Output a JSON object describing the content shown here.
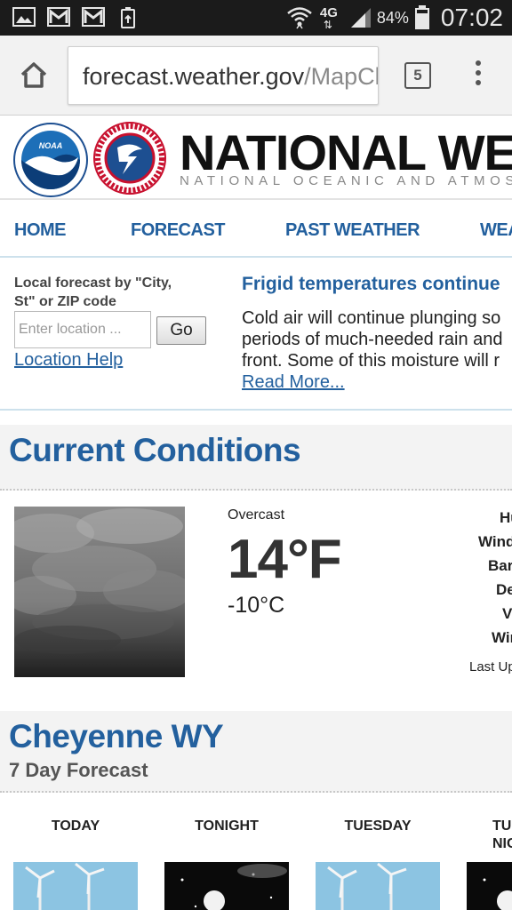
{
  "status_bar": {
    "network": "4G",
    "battery": "84%",
    "time": "07:02",
    "icons": [
      "gallery-icon",
      "gmail-icon",
      "gmail-icon",
      "battery-saver-icon",
      "wifi-icon",
      "signal-icon",
      "battery-icon"
    ]
  },
  "browser": {
    "url_main": "forecast.weather.gov",
    "url_rest": "/MapClick.php",
    "tab_count": "5"
  },
  "header": {
    "title": "NATIONAL WEATHER SERVICE",
    "subtitle": "NATIONAL OCEANIC AND ATMOSPHERIC ADMINISTRATION",
    "noaa_logo_text": "NOAA",
    "nws_logo_text": "NATIONAL WEATHER SERVICE"
  },
  "nav": {
    "items": [
      "HOME",
      "FORECAST",
      "PAST WEATHER",
      "WEATHER SAFETY"
    ]
  },
  "local": {
    "label": "Local forecast by \"City, St\" or ZIP code",
    "placeholder": "Enter location ...",
    "go_label": "Go",
    "help_link": "Location Help"
  },
  "news": {
    "title": "Frigid temperatures continue",
    "lines": [
      "Cold air will continue plunging so",
      "periods of much-needed rain and",
      "front. Some of this moisture will r"
    ],
    "read_more": "Read More..."
  },
  "current": {
    "title": "Current Conditions",
    "summary": "Overcast",
    "temp_f": "14°F",
    "temp_c": "-10°C",
    "details": [
      "Humidity",
      "Wind Speed",
      "Barometer",
      "Dewpoint",
      "Visibility",
      "Wind Chill"
    ],
    "last_update": "Last Update"
  },
  "forecast": {
    "city": "Cheyenne WY",
    "subtitle": "7 Day Forecast",
    "periods": [
      {
        "name": "TODAY",
        "icon": "wind-turbine-icon"
      },
      {
        "name": "TONIGHT",
        "icon": "night-moon-icon"
      },
      {
        "name": "TUESDAY",
        "icon": "wind-turbine-icon"
      },
      {
        "name": "TUESDAY NIGHT",
        "icon": "night-moon-icon"
      }
    ]
  },
  "colors": {
    "link_blue": "#23609e",
    "status_bar": "#1b1b1b",
    "section_bg": "#f3f3f3"
  }
}
